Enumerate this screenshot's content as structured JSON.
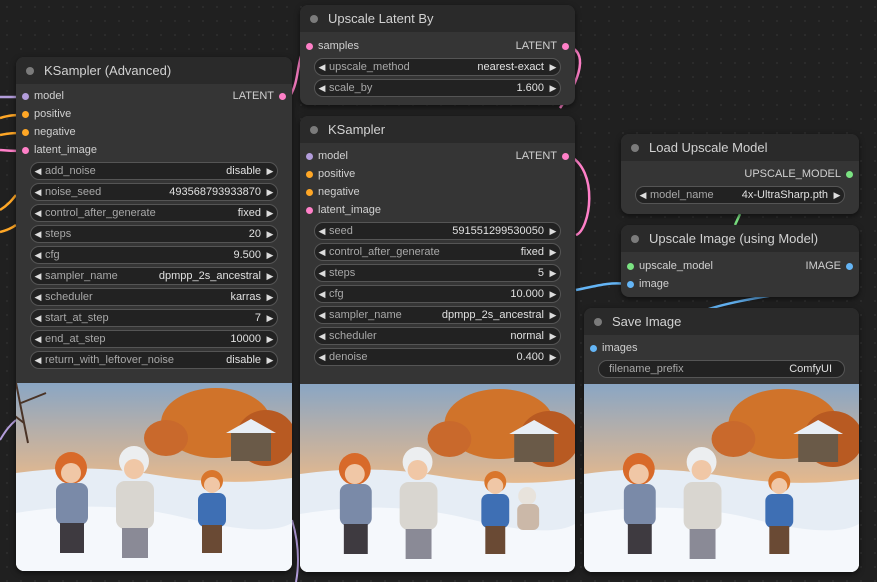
{
  "nodes": {
    "ksampler_adv": {
      "title": "KSampler (Advanced)",
      "inputs": [
        "model",
        "positive",
        "negative",
        "latent_image"
      ],
      "output": "LATENT",
      "widgets": [
        {
          "label": "add_noise",
          "value": "disable"
        },
        {
          "label": "noise_seed",
          "value": "493568793933870"
        },
        {
          "label": "control_after_generate",
          "value": "fixed"
        },
        {
          "label": "steps",
          "value": "20"
        },
        {
          "label": "cfg",
          "value": "9.500"
        },
        {
          "label": "sampler_name",
          "value": "dpmpp_2s_ancestral"
        },
        {
          "label": "scheduler",
          "value": "karras"
        },
        {
          "label": "start_at_step",
          "value": "7"
        },
        {
          "label": "end_at_step",
          "value": "10000"
        },
        {
          "label": "return_with_leftover_noise",
          "value": "disable"
        }
      ]
    },
    "upscale_latent": {
      "title": "Upscale Latent By",
      "input": "samples",
      "output": "LATENT",
      "widgets": [
        {
          "label": "upscale_method",
          "value": "nearest-exact"
        },
        {
          "label": "scale_by",
          "value": "1.600"
        }
      ]
    },
    "ksampler": {
      "title": "KSampler",
      "inputs": [
        "model",
        "positive",
        "negative",
        "latent_image"
      ],
      "output": "LATENT",
      "widgets": [
        {
          "label": "seed",
          "value": "591551299530050"
        },
        {
          "label": "control_after_generate",
          "value": "fixed"
        },
        {
          "label": "steps",
          "value": "5"
        },
        {
          "label": "cfg",
          "value": "10.000"
        },
        {
          "label": "sampler_name",
          "value": "dpmpp_2s_ancestral"
        },
        {
          "label": "scheduler",
          "value": "normal"
        },
        {
          "label": "denoise",
          "value": "0.400"
        }
      ]
    },
    "load_upscale": {
      "title": "Load Upscale Model",
      "output": "UPSCALE_MODEL",
      "widget": {
        "label": "model_name",
        "value": "4x-UltraSharp.pth"
      }
    },
    "upscale_image": {
      "title": "Upscale Image (using Model)",
      "inputs": [
        "upscale_model",
        "image"
      ],
      "output": "IMAGE"
    },
    "save_image": {
      "title": "Save Image",
      "input": "images",
      "widget": {
        "label": "filename_prefix",
        "value": "ComfyUI"
      }
    }
  },
  "colors": {
    "model": "#b39ddb",
    "conditioning": "#ffa726",
    "latent": "#ff80c8",
    "upscale_model": "#7be382",
    "image": "#64b5f6"
  }
}
